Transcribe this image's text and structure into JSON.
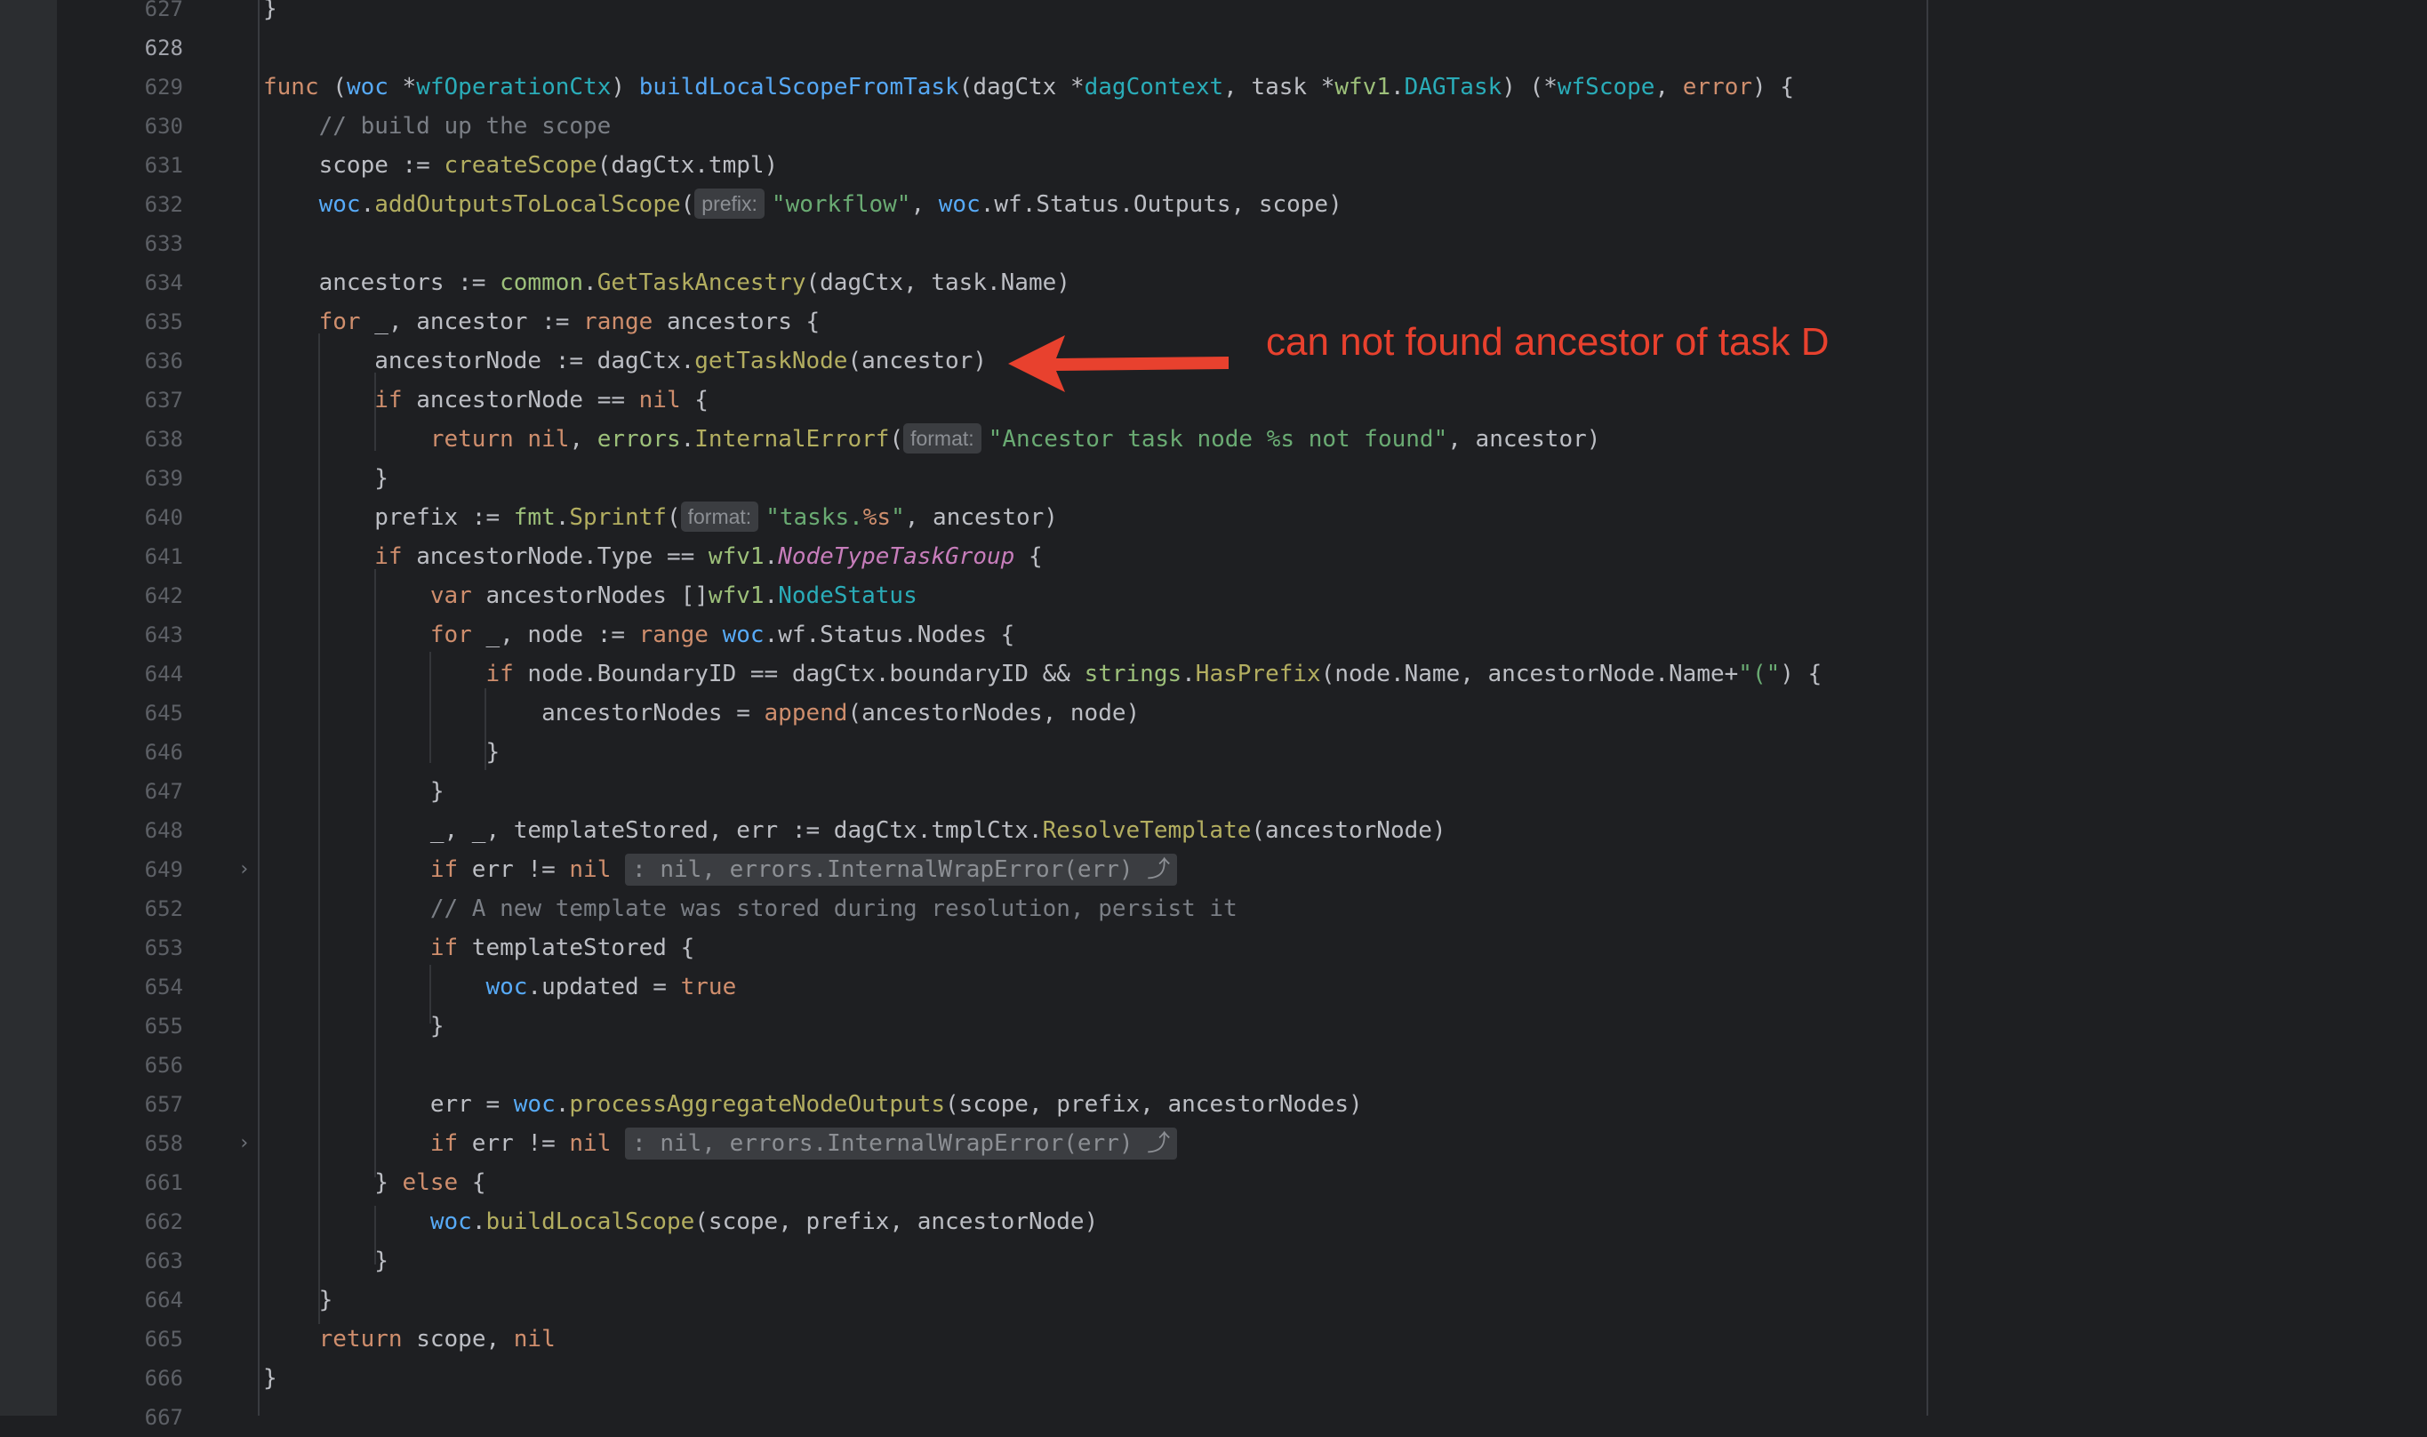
{
  "annotation": {
    "text": "can not found ancestor of task D",
    "color": "#e8412e"
  },
  "lines": [
    {
      "num": "627",
      "code": "}"
    },
    {
      "num": "628",
      "code": ""
    },
    {
      "num": "629",
      "code": "func (woc *wfOperationCtx) buildLocalScopeFromTask(dagCtx *dagContext, task *wfv1.DAGTask) (*wfScope, error) {"
    },
    {
      "num": "630",
      "code": "    // build up the scope"
    },
    {
      "num": "631",
      "code": "    scope := createScope(dagCtx.tmpl)"
    },
    {
      "num": "632",
      "code": "    woc.addOutputsToLocalScope( prefix: \"workflow\", woc.wf.Status.Outputs, scope)"
    },
    {
      "num": "633",
      "code": ""
    },
    {
      "num": "634",
      "code": "    ancestors := common.GetTaskAncestry(dagCtx, task.Name)"
    },
    {
      "num": "635",
      "code": "    for _, ancestor := range ancestors {"
    },
    {
      "num": "636",
      "code": "        ancestorNode := dagCtx.getTaskNode(ancestor)"
    },
    {
      "num": "637",
      "code": "        if ancestorNode == nil {"
    },
    {
      "num": "638",
      "code": "            return nil, errors.InternalErrorf( format: \"Ancestor task node %s not found\", ancestor)"
    },
    {
      "num": "639",
      "code": "        }"
    },
    {
      "num": "640",
      "code": "        prefix := fmt.Sprintf( format: \"tasks.%s\", ancestor)"
    },
    {
      "num": "641",
      "code": "        if ancestorNode.Type == wfv1.NodeTypeTaskGroup {"
    },
    {
      "num": "642",
      "code": "            var ancestorNodes []wfv1.NodeStatus"
    },
    {
      "num": "643",
      "code": "            for _, node := range woc.wf.Status.Nodes {"
    },
    {
      "num": "644",
      "code": "                if node.BoundaryID == dagCtx.boundaryID && strings.HasPrefix(node.Name, ancestorNode.Name+\"(\") {"
    },
    {
      "num": "645",
      "code": "                    ancestorNodes = append(ancestorNodes, node)"
    },
    {
      "num": "646",
      "code": "                }"
    },
    {
      "num": "647",
      "code": "            }"
    },
    {
      "num": "648",
      "code": "            _, _, templateStored, err := dagCtx.tmplCtx.ResolveTemplate(ancestorNode)"
    },
    {
      "num": "649",
      "code": "            if err != nil : nil, errors.InternalWrapError(err) ⤴"
    },
    {
      "num": "652",
      "code": "            // A new template was stored during resolution, persist it"
    },
    {
      "num": "653",
      "code": "            if templateStored {"
    },
    {
      "num": "654",
      "code": "                woc.updated = true"
    },
    {
      "num": "655",
      "code": "            }"
    },
    {
      "num": "656",
      "code": ""
    },
    {
      "num": "657",
      "code": "            err = woc.processAggregateNodeOutputs(scope, prefix, ancestorNodes)"
    },
    {
      "num": "658",
      "code": "            if err != nil : nil, errors.InternalWrapError(err) ⤴"
    },
    {
      "num": "661",
      "code": "        } else {"
    },
    {
      "num": "662",
      "code": "            woc.buildLocalScope(scope, prefix, ancestorNode)"
    },
    {
      "num": "663",
      "code": "        }"
    },
    {
      "num": "664",
      "code": "    }"
    },
    {
      "num": "665",
      "code": "    return scope, nil"
    },
    {
      "num": "666",
      "code": "}"
    },
    {
      "num": "667",
      "code": ""
    }
  ]
}
